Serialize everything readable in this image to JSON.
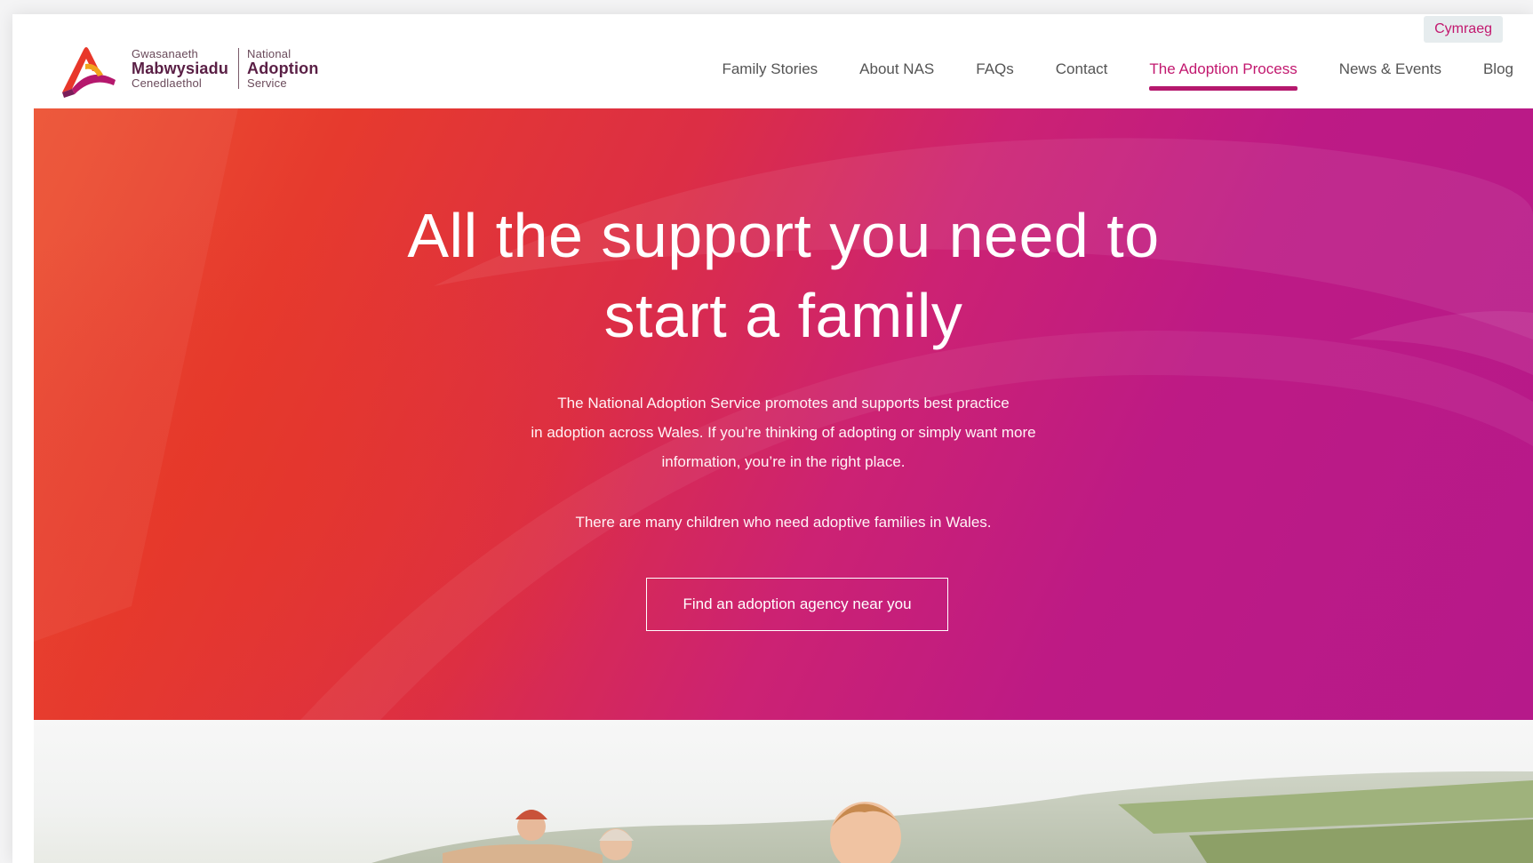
{
  "header": {
    "logo": {
      "welsh_line1": "Gwasanaeth",
      "welsh_line2": "Mabwysiadu",
      "welsh_line3": "Cenedlaethol",
      "english_line1": "National",
      "english_line2": "Adoption",
      "english_line3": "Service",
      "colors": [
        "#e8372a",
        "#b5186d",
        "#f2a21c",
        "#5a1f45"
      ]
    },
    "language_toggle": "Cymraeg",
    "nav": [
      {
        "label": "Family Stories",
        "active": false
      },
      {
        "label": "About NAS",
        "active": false
      },
      {
        "label": "FAQs",
        "active": false
      },
      {
        "label": "Contact",
        "active": false
      },
      {
        "label": "The Adoption Process",
        "active": true
      },
      {
        "label": "News & Events",
        "active": false
      },
      {
        "label": "Blog",
        "active": false
      }
    ]
  },
  "hero": {
    "title_line1": "All the support you need to",
    "title_line2": "start a family",
    "body_line1": "The National Adoption Service promotes and supports best practice",
    "body_line2": "in adoption across Wales. If you’re thinking of adopting or simply want more",
    "body_line3": "information, you’re in the right place.",
    "note": "There are many children who need adoptive families in Wales.",
    "cta": "Find an adoption agency near you",
    "gradient_colors": [
      "#ec5232",
      "#dc2e45",
      "#bd1a85"
    ]
  },
  "photo": {
    "icon": "family-photo"
  },
  "colors": {
    "accent": "#c2186f",
    "nav_text": "#545454",
    "lang_bg": "#e6ecee"
  }
}
